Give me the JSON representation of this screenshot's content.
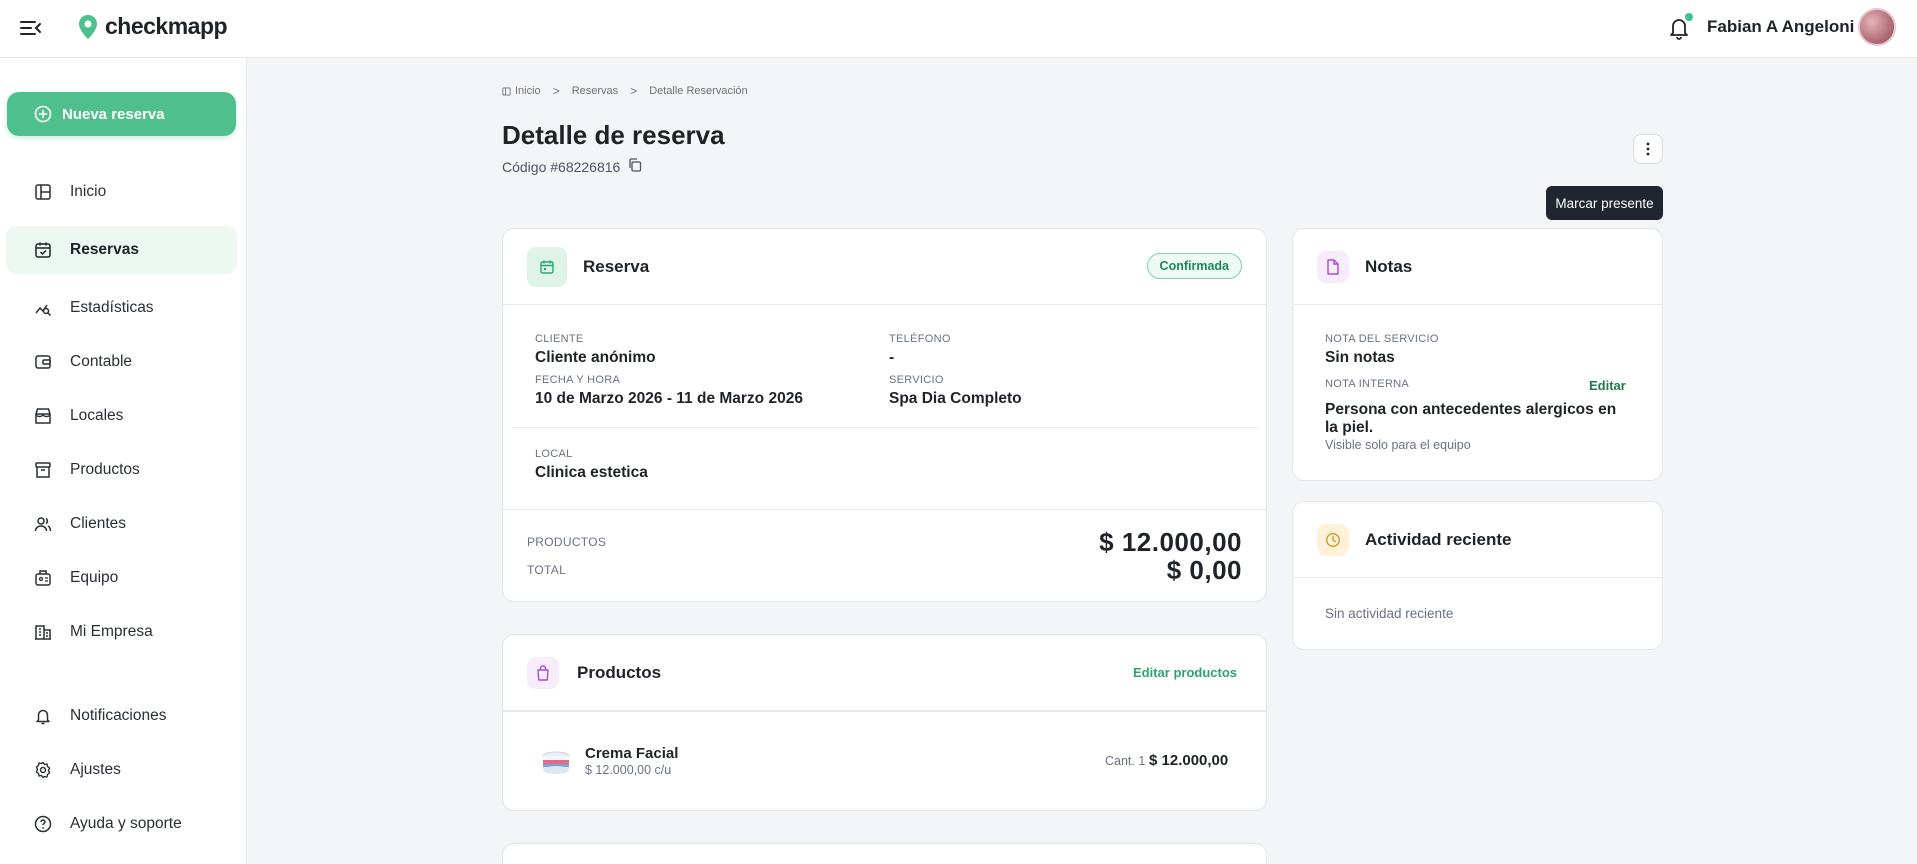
{
  "app": {
    "name": "checkmapp",
    "brand_color": "#4fc08d"
  },
  "user": {
    "name": "Fabian A Angeloni"
  },
  "sidebar": {
    "new_button": "Nueva reserva",
    "items": [
      {
        "label": "Inicio",
        "icon": "dashboard-icon"
      },
      {
        "label": "Reservas",
        "icon": "calendar-check-icon",
        "active": true
      },
      {
        "label": "Estadísticas",
        "icon": "chart-icon"
      },
      {
        "label": "Contable",
        "icon": "wallet-icon"
      },
      {
        "label": "Locales",
        "icon": "store-icon"
      },
      {
        "label": "Productos",
        "icon": "archive-icon"
      },
      {
        "label": "Clientes",
        "icon": "users-icon"
      },
      {
        "label": "Equipo",
        "icon": "team-icon"
      },
      {
        "label": "Mi Empresa",
        "icon": "building-icon"
      },
      {
        "label": "Notificaciones",
        "icon": "bell-icon"
      },
      {
        "label": "Ajustes",
        "icon": "gear-icon"
      },
      {
        "label": "Ayuda y soporte",
        "icon": "help-icon"
      }
    ]
  },
  "breadcrumb": {
    "home": "Inicio",
    "section": "Reservas",
    "current": "Detalle Reservación"
  },
  "page": {
    "title": "Detalle de reserva",
    "code": "Código #68226816",
    "tooltip": "Marcar presente"
  },
  "reserva": {
    "title": "Reserva",
    "status": "Confirmada",
    "cliente_label": "CLIENTE",
    "cliente": "Cliente anónimo",
    "telefono_label": "TELÉFONO",
    "telefono": "-",
    "fecha_label": "FECHA Y HORA",
    "fecha": "10 de Marzo 2026 - 11 de Marzo 2026",
    "servicio_label": "SERVICIO",
    "servicio": "Spa Dia Completo",
    "local_label": "LOCAL",
    "local": "Clinica estetica",
    "productos_label": "PRODUCTOS",
    "productos_amount": "$ 12.000,00",
    "total_label": "TOTAL",
    "total_amount": "$ 0,00"
  },
  "notas": {
    "title": "Notas",
    "servicio_label": "NOTA DEL SERVICIO",
    "servicio": "Sin notas",
    "interna_label": "NOTA INTERNA",
    "edit": "Editar",
    "interna": "Persona con antecedentes alergicos en la piel.",
    "interna_hint": "Visible solo para el equipo"
  },
  "actividad": {
    "title": "Actividad reciente",
    "empty": "Sin actividad reciente"
  },
  "productos": {
    "title": "Productos",
    "edit": "Editar productos",
    "items": [
      {
        "name": "Crema Facial",
        "unit_price": "$ 12.000,00 c/u",
        "qty": "Cant. 1",
        "price": "$ 12.000,00"
      }
    ]
  }
}
